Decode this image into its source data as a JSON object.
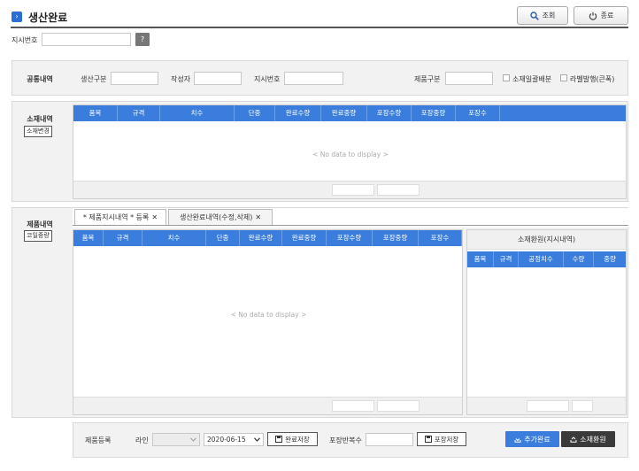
{
  "header": {
    "title": "생산완료",
    "search_label": "조회",
    "close_label": "종료"
  },
  "order": {
    "label": "지시번호",
    "value": "",
    "help": "?"
  },
  "common": {
    "title": "공통내역",
    "fields": {
      "prod_type": "생산구분",
      "author": "작성자",
      "order_no": "지시번호",
      "product_type": "제품구분"
    },
    "checks": {
      "material_batch": "소재일괄배분",
      "label_print": "라벨발행(큰폭)"
    }
  },
  "material": {
    "title": "소재내역",
    "change_btn": "소재변경",
    "columns": [
      "품목",
      "규격",
      "치수",
      "단중",
      "완료수량",
      "완료중량",
      "포장수량",
      "포장중량",
      "포장수"
    ],
    "empty": "< No data to display >"
  },
  "product": {
    "title": "제품내역",
    "coil_btn": "코일중량",
    "tabs": [
      {
        "label": "* 제품지시내역 * 등록",
        "close": "✕"
      },
      {
        "label": "생산완료내역(수정,삭제)",
        "close": "✕"
      }
    ],
    "columns": [
      "품목",
      "규격",
      "치수",
      "단중",
      "완료수량",
      "완료중량",
      "포장수량",
      "포장중량",
      "포장수"
    ],
    "empty": "< No data to display >",
    "return_panel": {
      "title": "소재환원(지시내역)",
      "columns": [
        "품목",
        "규격",
        "공정치수",
        "수량",
        "중량"
      ]
    }
  },
  "register": {
    "title": "제품등록",
    "line_label": "라인",
    "line_value": "",
    "date_value": "2020-06-15",
    "complete_save": "완료저장",
    "pack_repeat_label": "포장반복수",
    "pack_repeat_value": "",
    "pack_save": "포장저장",
    "add_complete": "추가완료",
    "material_return": "소재환원"
  },
  "colors": {
    "accent": "#3b7ddd",
    "dark_button": "#3a3a3a"
  }
}
